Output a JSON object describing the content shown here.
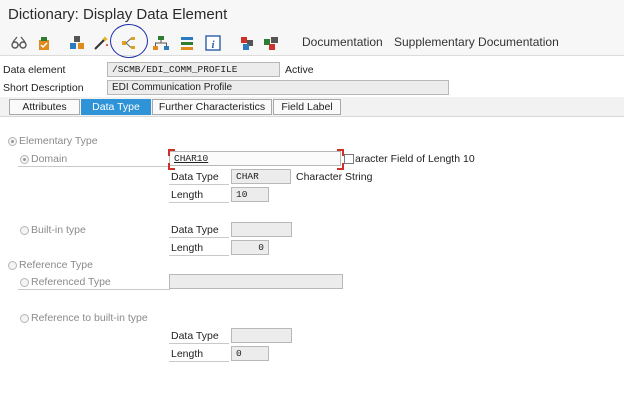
{
  "window": {
    "title": "Dictionary: Display Data Element"
  },
  "toolbar": {
    "icons": [
      "glasses-icon",
      "activate-icon",
      "where-used-icon",
      "magic-wand-icon",
      "navigate-hierarchy-icon",
      "hierarchy-tree-icon",
      "list-icon",
      "info-icon",
      "other-object-icon",
      "blocks-icon"
    ],
    "documentation_label": "Documentation",
    "supplementary_label": "Supplementary Documentation"
  },
  "header": {
    "data_element_label": "Data element",
    "data_element_value": "/SCMB/EDI_COMM_PROFILE",
    "status": "Active",
    "short_desc_label": "Short Description",
    "short_desc_value": "EDI Communication Profile"
  },
  "tabs": [
    {
      "label": "Attributes",
      "active": false
    },
    {
      "label": "Data Type",
      "active": true
    },
    {
      "label": "Further Characteristics",
      "active": false
    },
    {
      "label": "Field Label",
      "active": false
    }
  ],
  "elementary": {
    "label": "Elementary Type",
    "domain_label": "Domain",
    "domain_value": "CHAR10",
    "domain_desc": "aracter Field of Length 10",
    "data_type_label": "Data Type",
    "data_type_value": "CHAR",
    "data_type_desc": "Character String",
    "length_label": "Length",
    "length_value": "10",
    "builtin_label": "Built-in type",
    "builtin_data_type_label": "Data Type",
    "builtin_data_type_value": "",
    "builtin_length_label": "Length",
    "builtin_length_value": "0"
  },
  "reference": {
    "label": "Reference Type",
    "referenced_label": "Referenced Type",
    "referenced_value": "",
    "ref_builtin_label": "Reference to built-in type",
    "data_type_label": "Data Type",
    "data_type_value": "",
    "length_label": "Length",
    "length_value": "0"
  },
  "colors": {
    "active_tab": "#2f93d7",
    "annotation_circle": "#1c2ea8",
    "required_corner": "#d0302a"
  }
}
